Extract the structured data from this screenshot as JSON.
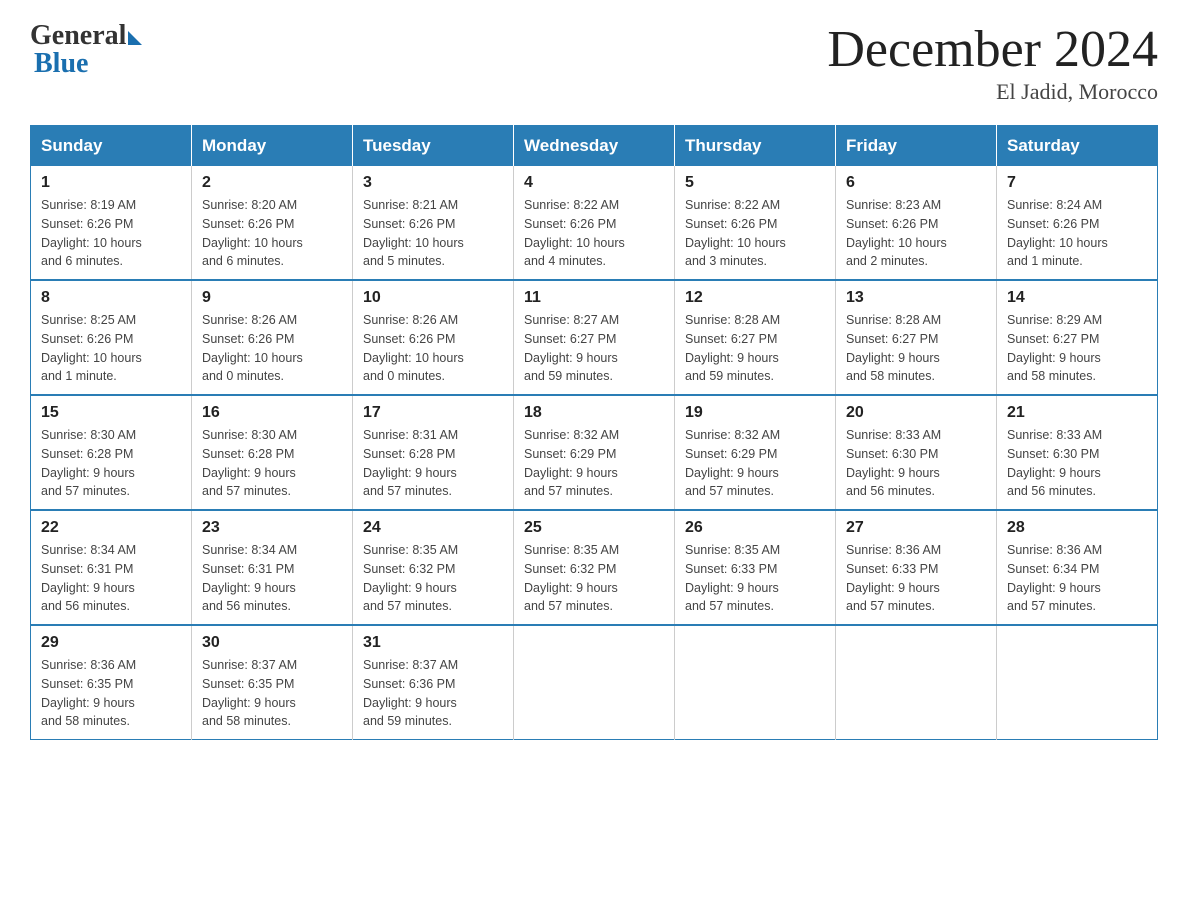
{
  "header": {
    "logo_general": "General",
    "logo_blue": "Blue",
    "main_title": "December 2024",
    "subtitle": "El Jadid, Morocco"
  },
  "calendar": {
    "days_of_week": [
      "Sunday",
      "Monday",
      "Tuesday",
      "Wednesday",
      "Thursday",
      "Friday",
      "Saturday"
    ],
    "weeks": [
      [
        {
          "day": "1",
          "info": "Sunrise: 8:19 AM\nSunset: 6:26 PM\nDaylight: 10 hours\nand 6 minutes."
        },
        {
          "day": "2",
          "info": "Sunrise: 8:20 AM\nSunset: 6:26 PM\nDaylight: 10 hours\nand 6 minutes."
        },
        {
          "day": "3",
          "info": "Sunrise: 8:21 AM\nSunset: 6:26 PM\nDaylight: 10 hours\nand 5 minutes."
        },
        {
          "day": "4",
          "info": "Sunrise: 8:22 AM\nSunset: 6:26 PM\nDaylight: 10 hours\nand 4 minutes."
        },
        {
          "day": "5",
          "info": "Sunrise: 8:22 AM\nSunset: 6:26 PM\nDaylight: 10 hours\nand 3 minutes."
        },
        {
          "day": "6",
          "info": "Sunrise: 8:23 AM\nSunset: 6:26 PM\nDaylight: 10 hours\nand 2 minutes."
        },
        {
          "day": "7",
          "info": "Sunrise: 8:24 AM\nSunset: 6:26 PM\nDaylight: 10 hours\nand 1 minute."
        }
      ],
      [
        {
          "day": "8",
          "info": "Sunrise: 8:25 AM\nSunset: 6:26 PM\nDaylight: 10 hours\nand 1 minute."
        },
        {
          "day": "9",
          "info": "Sunrise: 8:26 AM\nSunset: 6:26 PM\nDaylight: 10 hours\nand 0 minutes."
        },
        {
          "day": "10",
          "info": "Sunrise: 8:26 AM\nSunset: 6:26 PM\nDaylight: 10 hours\nand 0 minutes."
        },
        {
          "day": "11",
          "info": "Sunrise: 8:27 AM\nSunset: 6:27 PM\nDaylight: 9 hours\nand 59 minutes."
        },
        {
          "day": "12",
          "info": "Sunrise: 8:28 AM\nSunset: 6:27 PM\nDaylight: 9 hours\nand 59 minutes."
        },
        {
          "day": "13",
          "info": "Sunrise: 8:28 AM\nSunset: 6:27 PM\nDaylight: 9 hours\nand 58 minutes."
        },
        {
          "day": "14",
          "info": "Sunrise: 8:29 AM\nSunset: 6:27 PM\nDaylight: 9 hours\nand 58 minutes."
        }
      ],
      [
        {
          "day": "15",
          "info": "Sunrise: 8:30 AM\nSunset: 6:28 PM\nDaylight: 9 hours\nand 57 minutes."
        },
        {
          "day": "16",
          "info": "Sunrise: 8:30 AM\nSunset: 6:28 PM\nDaylight: 9 hours\nand 57 minutes."
        },
        {
          "day": "17",
          "info": "Sunrise: 8:31 AM\nSunset: 6:28 PM\nDaylight: 9 hours\nand 57 minutes."
        },
        {
          "day": "18",
          "info": "Sunrise: 8:32 AM\nSunset: 6:29 PM\nDaylight: 9 hours\nand 57 minutes."
        },
        {
          "day": "19",
          "info": "Sunrise: 8:32 AM\nSunset: 6:29 PM\nDaylight: 9 hours\nand 57 minutes."
        },
        {
          "day": "20",
          "info": "Sunrise: 8:33 AM\nSunset: 6:30 PM\nDaylight: 9 hours\nand 56 minutes."
        },
        {
          "day": "21",
          "info": "Sunrise: 8:33 AM\nSunset: 6:30 PM\nDaylight: 9 hours\nand 56 minutes."
        }
      ],
      [
        {
          "day": "22",
          "info": "Sunrise: 8:34 AM\nSunset: 6:31 PM\nDaylight: 9 hours\nand 56 minutes."
        },
        {
          "day": "23",
          "info": "Sunrise: 8:34 AM\nSunset: 6:31 PM\nDaylight: 9 hours\nand 56 minutes."
        },
        {
          "day": "24",
          "info": "Sunrise: 8:35 AM\nSunset: 6:32 PM\nDaylight: 9 hours\nand 57 minutes."
        },
        {
          "day": "25",
          "info": "Sunrise: 8:35 AM\nSunset: 6:32 PM\nDaylight: 9 hours\nand 57 minutes."
        },
        {
          "day": "26",
          "info": "Sunrise: 8:35 AM\nSunset: 6:33 PM\nDaylight: 9 hours\nand 57 minutes."
        },
        {
          "day": "27",
          "info": "Sunrise: 8:36 AM\nSunset: 6:33 PM\nDaylight: 9 hours\nand 57 minutes."
        },
        {
          "day": "28",
          "info": "Sunrise: 8:36 AM\nSunset: 6:34 PM\nDaylight: 9 hours\nand 57 minutes."
        }
      ],
      [
        {
          "day": "29",
          "info": "Sunrise: 8:36 AM\nSunset: 6:35 PM\nDaylight: 9 hours\nand 58 minutes."
        },
        {
          "day": "30",
          "info": "Sunrise: 8:37 AM\nSunset: 6:35 PM\nDaylight: 9 hours\nand 58 minutes."
        },
        {
          "day": "31",
          "info": "Sunrise: 8:37 AM\nSunset: 6:36 PM\nDaylight: 9 hours\nand 59 minutes."
        },
        {
          "day": "",
          "info": ""
        },
        {
          "day": "",
          "info": ""
        },
        {
          "day": "",
          "info": ""
        },
        {
          "day": "",
          "info": ""
        }
      ]
    ]
  }
}
